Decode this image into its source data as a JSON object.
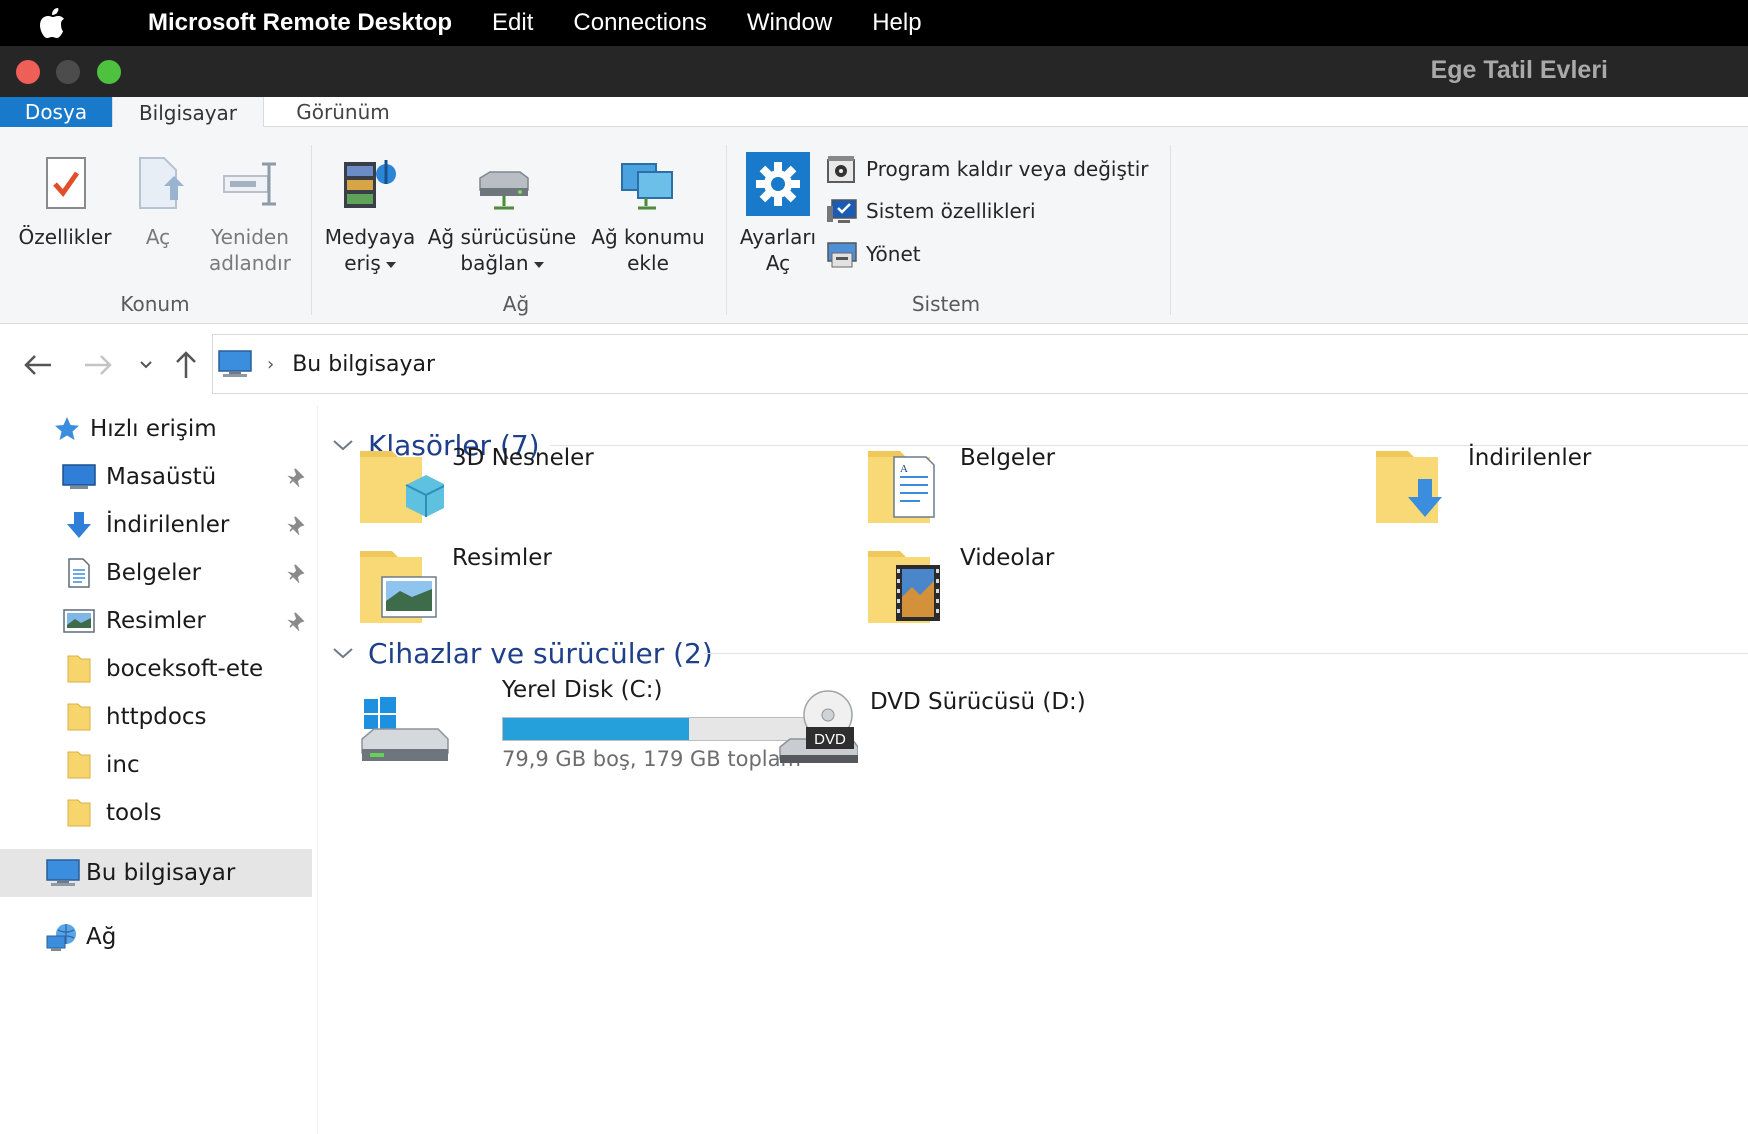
{
  "mac_menubar": {
    "app_name": "Microsoft Remote Desktop",
    "items": [
      "Edit",
      "Connections",
      "Window",
      "Help"
    ]
  },
  "window": {
    "title": "Ege Tatil Evleri"
  },
  "ribbon": {
    "tabs": {
      "file": "Dosya",
      "computer": "Bilgisayar",
      "view": "Görünüm"
    },
    "location_group": {
      "label": "Konum",
      "properties": "Özellikler",
      "open": "Aç",
      "rename_1": "Yeniden",
      "rename_2": "adlandır"
    },
    "network_group": {
      "label": "Ağ",
      "media_1": "Medyaya",
      "media_2": "eriş",
      "map_drive_1": "Ağ sürücüsüne",
      "map_drive_2": "bağlan",
      "add_location_1": "Ağ konumu",
      "add_location_2": "ekle"
    },
    "system_group": {
      "label": "Sistem",
      "settings_1": "Ayarları",
      "settings_2": "Aç",
      "uninstall": "Program kaldır veya değiştir",
      "sys_props": "Sistem özellikleri",
      "manage": "Yönet"
    }
  },
  "navigation": {
    "breadcrumb": "Bu bilgisayar"
  },
  "sidebar": {
    "quick_access": "Hızlı erişim",
    "items": [
      {
        "label": "Masaüstü",
        "pinned": true
      },
      {
        "label": "İndirilenler",
        "pinned": true
      },
      {
        "label": "Belgeler",
        "pinned": true
      },
      {
        "label": "Resimler",
        "pinned": true
      },
      {
        "label": "boceksoft-ete",
        "pinned": false
      },
      {
        "label": "httpdocs",
        "pinned": false
      },
      {
        "label": "inc",
        "pinned": false
      },
      {
        "label": "tools",
        "pinned": false
      }
    ],
    "this_pc": "Bu bilgisayar",
    "network": "Ağ"
  },
  "content": {
    "folders_header": "Klasörler (7)",
    "folders": [
      "3D Nesneler",
      "Belgeler",
      "İndirilenler",
      "Resimler",
      "Videolar"
    ],
    "devices_header": "Cihazlar ve sürücüler (2)",
    "drives": [
      {
        "name": "Yerel Disk (C:)",
        "usage": "79,9 GB boş, 179 GB toplam",
        "used_fraction": 0.554
      },
      {
        "name": "DVD Sürücüsü (D:)"
      }
    ],
    "dvd_badge": "DVD"
  },
  "colors": {
    "accent": "#1979ca",
    "header_text": "#1e3f8a",
    "progress": "#26a0da",
    "folder": "#f7d46c"
  }
}
